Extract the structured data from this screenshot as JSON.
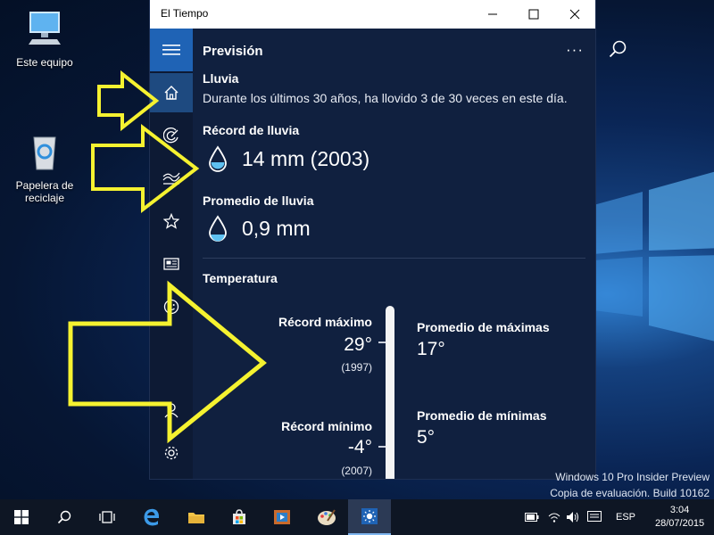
{
  "desktop": {
    "icons": [
      {
        "label": "Este equipo"
      },
      {
        "label": "Papelera de reciclaje"
      }
    ],
    "watermark": {
      "line1": "Windows 10 Pro Insider Preview",
      "line2": "Copia de evaluación. Build 10162"
    }
  },
  "window": {
    "title": "El Tiempo",
    "controls": [
      "minimize",
      "maximize",
      "close"
    ]
  },
  "sidebar": {
    "items": [
      {
        "icon": "hamburger-icon",
        "active": false
      },
      {
        "icon": "home-icon",
        "active": true
      },
      {
        "icon": "radar-icon",
        "active": false
      },
      {
        "icon": "historical-chart-icon",
        "active": false
      },
      {
        "icon": "star-icon",
        "active": false
      },
      {
        "icon": "news-icon",
        "active": false
      },
      {
        "icon": "smiley-icon",
        "active": false
      },
      {
        "icon": "account-icon",
        "active": false
      },
      {
        "icon": "settings-icon",
        "active": false
      }
    ]
  },
  "header": {
    "title": "Previsión",
    "more": "···"
  },
  "rain": {
    "heading": "Lluvia",
    "description": "Durante los últimos 30 años, ha llovido 3 de 30 veces en este día.",
    "record_heading": "Récord de lluvia",
    "record_value": "14 mm (2003)",
    "average_heading": "Promedio de lluvia",
    "average_value": "0,9 mm"
  },
  "temperature": {
    "heading": "Temperatura",
    "record_max_label": "Récord máximo",
    "record_max_value": "29°",
    "record_max_year": "(1997)",
    "avg_max_label": "Promedio de máximas",
    "avg_max_value": "17°",
    "record_min_label": "Récord mínimo",
    "record_min_value": "-4°",
    "record_min_year": "(2007)",
    "avg_min_label": "Promedio de mínimas",
    "avg_min_value": "5°"
  },
  "taskbar": {
    "language": "ESP",
    "time": "3:04",
    "date": "28/07/2015"
  },
  "colors": {
    "accent": "#1f63b5",
    "app_bg": "#10203f",
    "sidebar_bg": "#0d1a34",
    "annotation_arrow": "#f5f230"
  }
}
